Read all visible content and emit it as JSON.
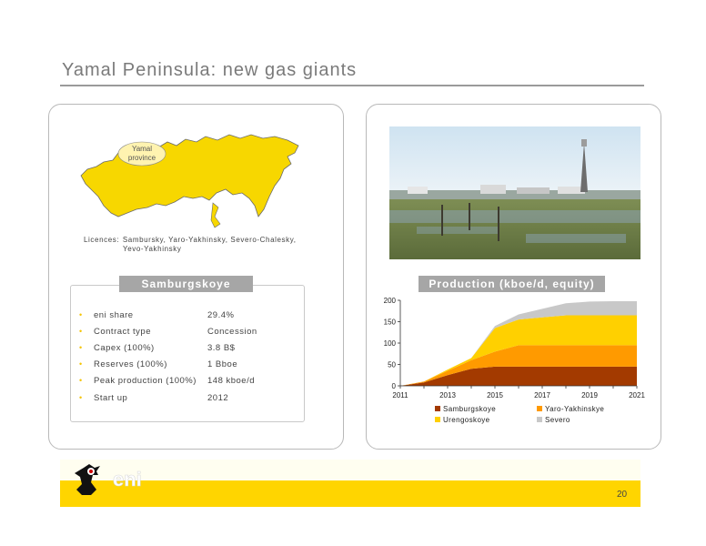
{
  "title": "Yamal Peninsula: new gas giants",
  "map": {
    "label_line1": "Yamal",
    "label_line2": "province",
    "licences_label": "Licences:",
    "licences_line1": "Sambursky, Yaro-Yakhinsky, Severo-Chalesky,",
    "licences_line2": "Yevo-Yakhinsky"
  },
  "samburgskoye": {
    "header": "Samburgskoye",
    "rows": [
      {
        "label": "eni share",
        "value": "29.4%"
      },
      {
        "label": "Contract type",
        "value": "Concession"
      },
      {
        "label": "Capex (100%)",
        "value": "3.8 B$"
      },
      {
        "label": "Reserves  (100%)",
        "value": "1 Bboe"
      },
      {
        "label": "Peak production (100%)",
        "value": "148 kboe/d"
      },
      {
        "label": "Start up",
        "value": "2012"
      }
    ]
  },
  "production": {
    "header": "Production (kboe/d, equity)"
  },
  "chart_data": {
    "type": "area",
    "stacked": true,
    "title": "Production (kboe/d, equity)",
    "x": [
      2011,
      2012,
      2013,
      2014,
      2015,
      2016,
      2017,
      2018,
      2019,
      2020,
      2021
    ],
    "xticks": [
      "2011",
      "2013",
      "2015",
      "2017",
      "2019",
      "2021"
    ],
    "ylim": [
      0,
      200
    ],
    "yticks": [
      "0",
      "50",
      "100",
      "150",
      "200"
    ],
    "legend_position": "bottom",
    "series": [
      {
        "name": "Samburgskoye",
        "color": "#a33a00",
        "values": [
          0,
          8,
          25,
          40,
          45,
          45,
          45,
          45,
          45,
          45,
          45
        ]
      },
      {
        "name": "Yaro-Yakhinskye",
        "color": "#ff9a00",
        "values": [
          0,
          2,
          10,
          20,
          35,
          50,
          50,
          50,
          50,
          50,
          50
        ]
      },
      {
        "name": "Urengoskoye",
        "color": "#ffd000",
        "values": [
          0,
          0,
          3,
          5,
          55,
          60,
          65,
          70,
          70,
          70,
          70
        ]
      },
      {
        "name": "Severo",
        "color": "#c8c8c8",
        "values": [
          0,
          0,
          0,
          0,
          5,
          12,
          20,
          28,
          32,
          33,
          33
        ]
      }
    ]
  },
  "colors": {
    "accent": "#ffd500",
    "header_gray": "#a6a6a6",
    "map_fill": "#f7d700"
  },
  "footer": {
    "page_number": "20",
    "logo_text": "eni"
  }
}
